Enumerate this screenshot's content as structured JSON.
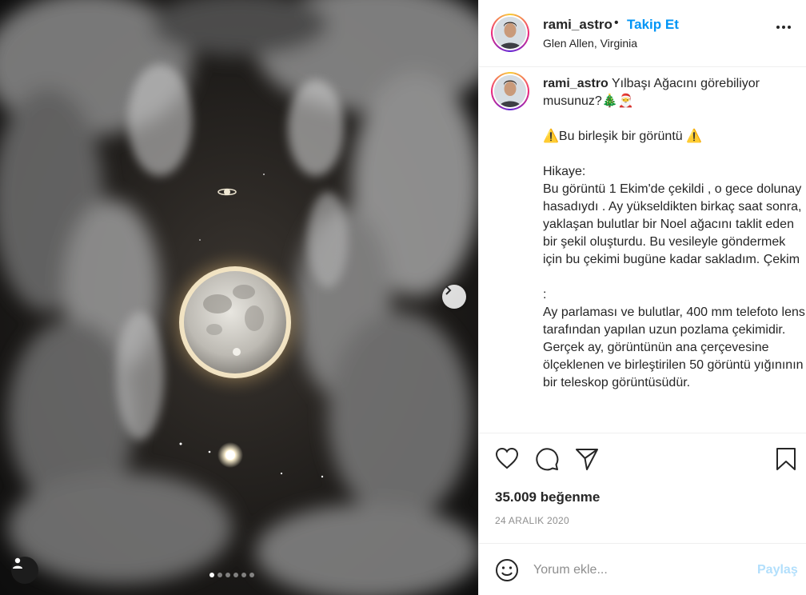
{
  "post": {
    "username": "rami_astro",
    "bullet": "•",
    "follow_label": "Takip Et",
    "location": "Glen Allen, Virginia",
    "caption_text": "Yılbaşı Ağacını görebiliyor musunuz?🎄🎅\n\n⚠️Bu birleşik bir görüntü ⚠️\n\nHikaye:\nBu görüntü 1 Ekim'de çekildi , o gece dolunay hasadıydı . Ay yükseldikten birkaç saat sonra, yaklaşan bulutlar bir Noel ağacını taklit eden bir şekil oluşturdu. Bu vesileyle göndermek için bu çekimi bugüne kadar sakladım. Çekim\n\n:\nAy parlaması ve bulutlar, 400 mm telefoto lens tarafından yapılan uzun pozlama çekimidir. Gerçek ay, görüntünün ana çerçevesine ölçeklenen ve birleştirilen 50 görüntü yığınının bir teleskop görüntüsüdür.",
    "likes": "35.009 beğenme",
    "date": "24 ARALIK 2020"
  },
  "media": {
    "slide_count": 6,
    "active_slide": 1
  },
  "comment": {
    "placeholder": "Yorum ekle...",
    "post_label": "Paylaş"
  },
  "icons": {
    "like": "heart-icon",
    "comment": "comment-icon",
    "share": "paper-plane-icon",
    "save": "bookmark-icon",
    "more": "more-dots-icon",
    "next": "chevron-right-icon",
    "tag": "user-tag-icon",
    "emoji": "smiley-icon"
  },
  "colors": {
    "follow": "#0095f6",
    "post_disabled": "#b2dffc",
    "muted": "#8e8e8e"
  }
}
